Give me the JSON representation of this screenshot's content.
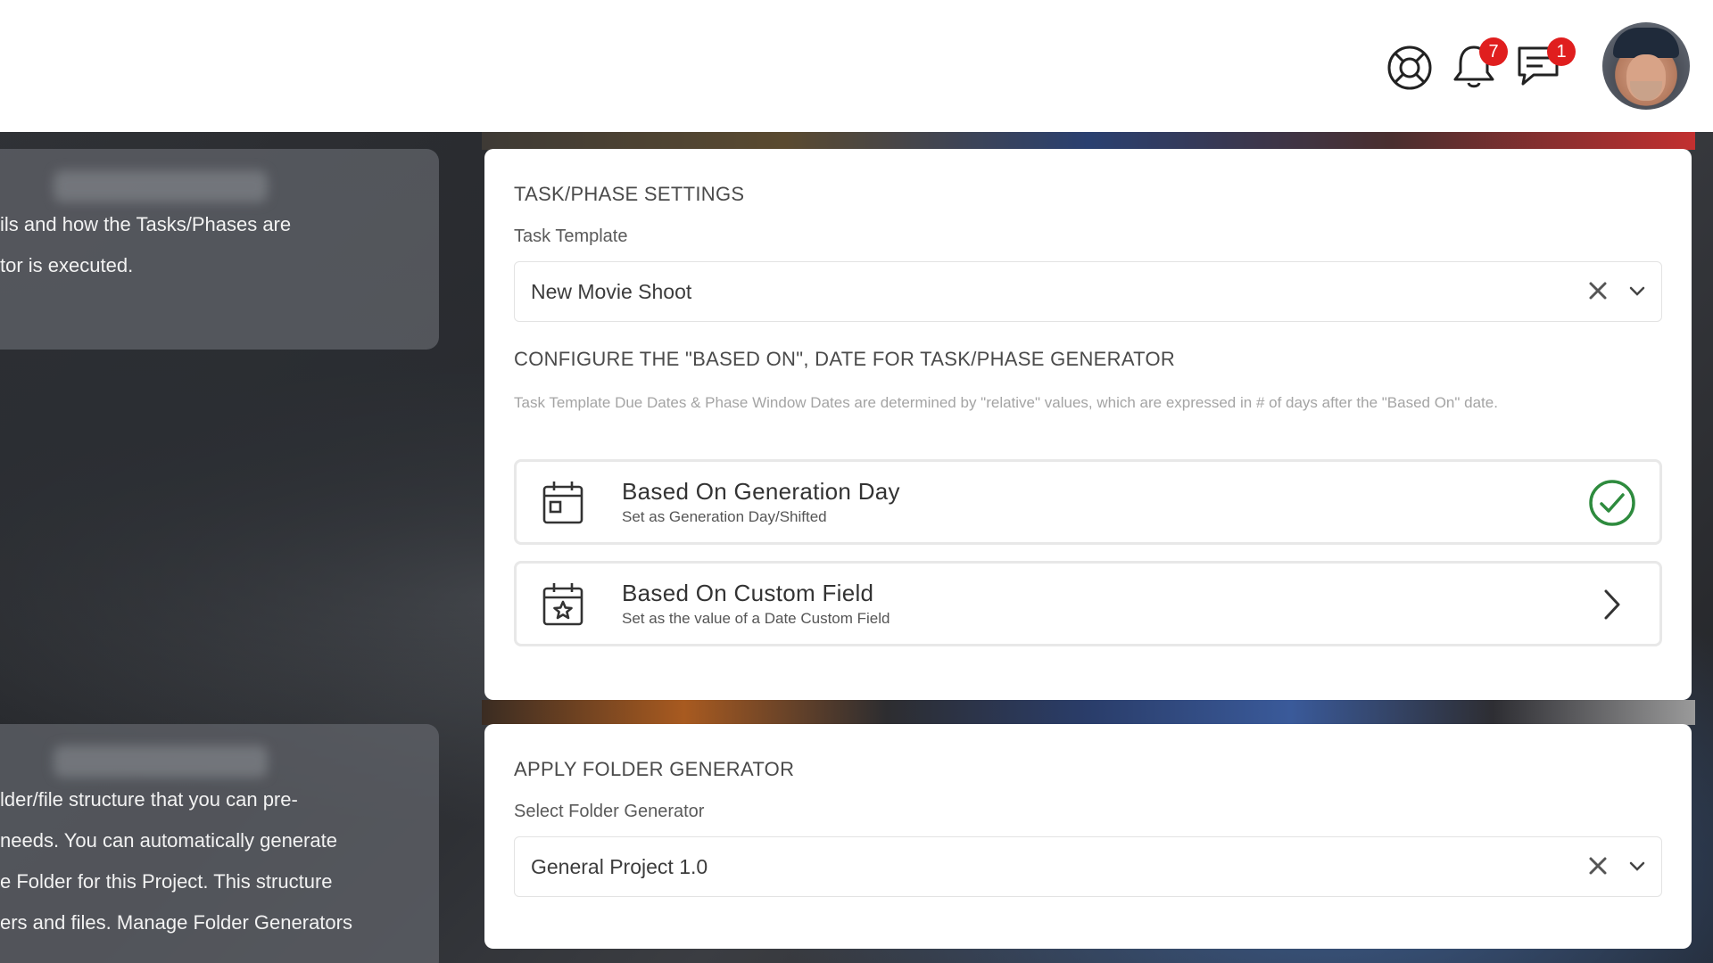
{
  "header": {
    "notifications_count": "7",
    "messages_count": "1"
  },
  "side_panels": {
    "task_info": {
      "lines": [
        "ils and how the Tasks/Phases are",
        "tor is executed."
      ]
    },
    "folder_info": {
      "lines": [
        "lder/file structure that you can pre-",
        " needs. You can automatically generate",
        "e Folder for this Project. This structure",
        "ers and files. Manage Folder Generators"
      ]
    }
  },
  "task_settings": {
    "title": "TASK/PHASE SETTINGS",
    "template_label": "Task Template",
    "template_value": "New Movie Shoot",
    "based_on_title": "CONFIGURE THE \"BASED ON\", DATE FOR TASK/PHASE GENERATOR",
    "help_text": "Task Template Due Dates & Phase Window Dates are determined by \"relative\" values, which are expressed in # of days after the \"Based On\" date.",
    "options": [
      {
        "title": "Based On Generation Day",
        "subtitle": "Set as Generation Day/Shifted",
        "selected": true
      },
      {
        "title": "Based On Custom Field",
        "subtitle": "Set as the value of a Date Custom Field",
        "selected": false
      }
    ]
  },
  "folder_generator": {
    "title": "APPLY FOLDER GENERATOR",
    "select_label": "Select Folder Generator",
    "select_value": "General Project 1.0"
  },
  "colors": {
    "badge": "#e01e1e",
    "check": "#2e8b3e"
  }
}
